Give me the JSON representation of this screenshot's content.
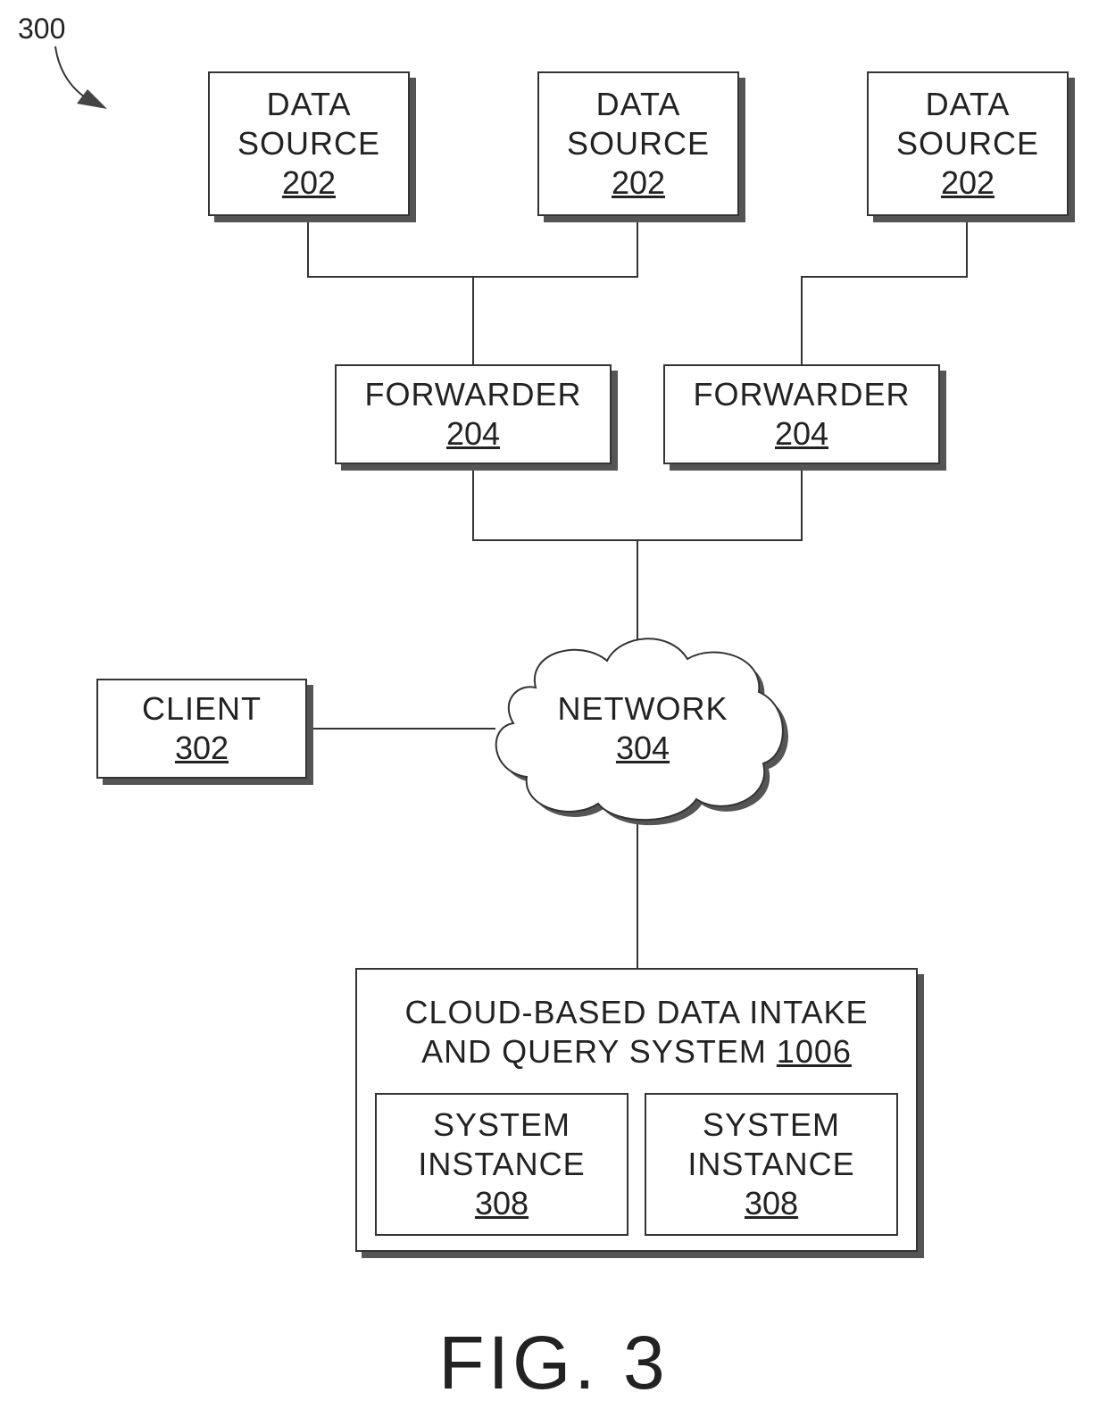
{
  "figure": {
    "number_label": "300",
    "caption": "FIG. 3"
  },
  "data_sources": [
    {
      "label_line1": "DATA",
      "label_line2": "SOURCE",
      "ref": "202"
    },
    {
      "label_line1": "DATA",
      "label_line2": "SOURCE",
      "ref": "202"
    },
    {
      "label_line1": "DATA",
      "label_line2": "SOURCE",
      "ref": "202"
    }
  ],
  "forwarders": [
    {
      "label": "FORWARDER",
      "ref": "204"
    },
    {
      "label": "FORWARDER",
      "ref": "204"
    }
  ],
  "client": {
    "label": "CLIENT",
    "ref": "302"
  },
  "network": {
    "label": "NETWORK",
    "ref": "304"
  },
  "cloud_system": {
    "label_line1": "CLOUD-BASED DATA INTAKE",
    "label_line2": "AND QUERY SYSTEM",
    "ref": "1006",
    "instances": [
      {
        "label_line1": "SYSTEM",
        "label_line2": "INSTANCE",
        "ref": "308"
      },
      {
        "label_line1": "SYSTEM",
        "label_line2": "INSTANCE",
        "ref": "308"
      }
    ]
  }
}
